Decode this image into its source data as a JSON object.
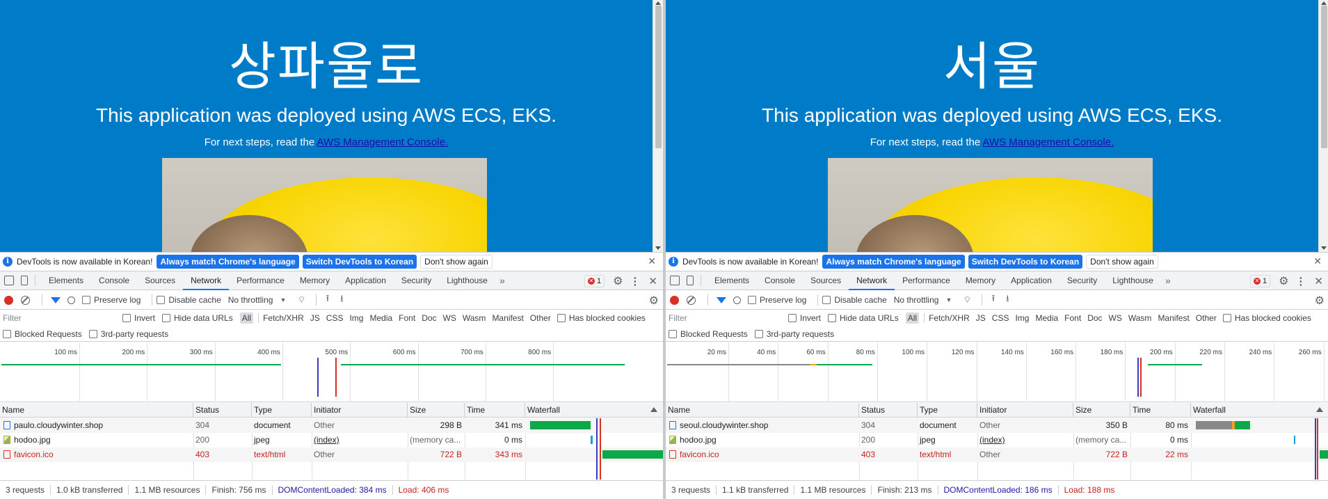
{
  "panes": [
    {
      "page": {
        "heading": "상파울로",
        "subheading": "This application was deployed using AWS ECS, EKS.",
        "steps_text": "For next steps, read the ",
        "steps_link": "AWS Management Console."
      },
      "infobar": {
        "message": "DevTools is now available in Korean!",
        "btn_match": "Always match Chrome's language",
        "btn_switch": "Switch DevTools to Korean",
        "btn_dismiss": "Don't show again"
      },
      "tabs": [
        "Elements",
        "Console",
        "Sources",
        "Network",
        "Performance",
        "Memory",
        "Application",
        "Security",
        "Lighthouse"
      ],
      "error_count": "1",
      "toolbar": {
        "preserve_log": "Preserve log",
        "disable_cache": "Disable cache",
        "throttle": "No throttling"
      },
      "filter": {
        "placeholder": "Filter",
        "invert": "Invert",
        "hide_data_urls": "Hide data URLs",
        "types": [
          "All",
          "Fetch/XHR",
          "JS",
          "CSS",
          "Img",
          "Media",
          "Font",
          "Doc",
          "WS",
          "Wasm",
          "Manifest",
          "Other"
        ],
        "has_blocked": "Has blocked cookies",
        "blocked_requests": "Blocked Requests",
        "third_party": "3rd-party requests"
      },
      "overview_ticks": [
        "100 ms",
        "200 ms",
        "300 ms",
        "400 ms",
        "500 ms",
        "600 ms",
        "700 ms",
        "800 ms"
      ],
      "columns": [
        "Name",
        "Status",
        "Type",
        "Initiator",
        "Size",
        "Time",
        "Waterfall"
      ],
      "rows": [
        {
          "name": "paulo.cloudywinter.shop",
          "status": "304",
          "type": "document",
          "initiator": "Other",
          "size": "298 B",
          "time": "341 ms",
          "kind": "doc",
          "error": false
        },
        {
          "name": "hodoo.jpg",
          "status": "200",
          "type": "jpeg",
          "initiator": "(index)",
          "size": "(memory ca...",
          "time": "0 ms",
          "kind": "img",
          "error": false
        },
        {
          "name": "favicon.ico",
          "status": "403",
          "type": "text/html",
          "initiator": "Other",
          "size": "722 B",
          "time": "343 ms",
          "kind": "err",
          "error": true
        }
      ],
      "status": {
        "requests": "3 requests",
        "transferred": "1.0 kB transferred",
        "resources": "1.1 MB resources",
        "finish": "Finish: 756 ms",
        "dcl": "DOMContentLoaded: 384 ms",
        "load": "Load: 406 ms"
      }
    },
    {
      "page": {
        "heading": "서울",
        "subheading": "This application was deployed using AWS ECS, EKS.",
        "steps_text": "For next steps, read the ",
        "steps_link": "AWS Management Console."
      },
      "infobar": {
        "message": "DevTools is now available in Korean!",
        "btn_match": "Always match Chrome's language",
        "btn_switch": "Switch DevTools to Korean",
        "btn_dismiss": "Don't show again"
      },
      "tabs": [
        "Elements",
        "Console",
        "Sources",
        "Network",
        "Performance",
        "Memory",
        "Application",
        "Security",
        "Lighthouse"
      ],
      "error_count": "1",
      "toolbar": {
        "preserve_log": "Preserve log",
        "disable_cache": "Disable cache",
        "throttle": "No throttling"
      },
      "filter": {
        "placeholder": "Filter",
        "invert": "Invert",
        "hide_data_urls": "Hide data URLs",
        "types": [
          "All",
          "Fetch/XHR",
          "JS",
          "CSS",
          "Img",
          "Media",
          "Font",
          "Doc",
          "WS",
          "Wasm",
          "Manifest",
          "Other"
        ],
        "has_blocked": "Has blocked cookies",
        "blocked_requests": "Blocked Requests",
        "third_party": "3rd-party requests"
      },
      "overview_ticks": [
        "20 ms",
        "40 ms",
        "60 ms",
        "80 ms",
        "100 ms",
        "120 ms",
        "140 ms",
        "160 ms",
        "180 ms",
        "200 ms",
        "220 ms",
        "240 ms",
        "260 ms"
      ],
      "columns": [
        "Name",
        "Status",
        "Type",
        "Initiator",
        "Size",
        "Time",
        "Waterfall"
      ],
      "rows": [
        {
          "name": "seoul.cloudywinter.shop",
          "status": "304",
          "type": "document",
          "initiator": "Other",
          "size": "350 B",
          "time": "80 ms",
          "kind": "doc",
          "error": false
        },
        {
          "name": "hodoo.jpg",
          "status": "200",
          "type": "jpeg",
          "initiator": "(index)",
          "size": "(memory ca...",
          "time": "0 ms",
          "kind": "img",
          "error": false
        },
        {
          "name": "favicon.ico",
          "status": "403",
          "type": "text/html",
          "initiator": "Other",
          "size": "722 B",
          "time": "22 ms",
          "kind": "err",
          "error": true
        }
      ],
      "status": {
        "requests": "3 requests",
        "transferred": "1.1 kB transferred",
        "resources": "1.1 MB resources",
        "finish": "Finish: 213 ms",
        "dcl": "DOMContentLoaded: 186 ms",
        "load": "Load: 188 ms"
      }
    }
  ],
  "colors": {
    "page_bg": "#007bc7",
    "accent": "#1a73e8",
    "error": "#c5221f",
    "waterfall_green": "#0ca84a",
    "dcl_line": "#3a3ac4",
    "load_line": "#d93025"
  }
}
